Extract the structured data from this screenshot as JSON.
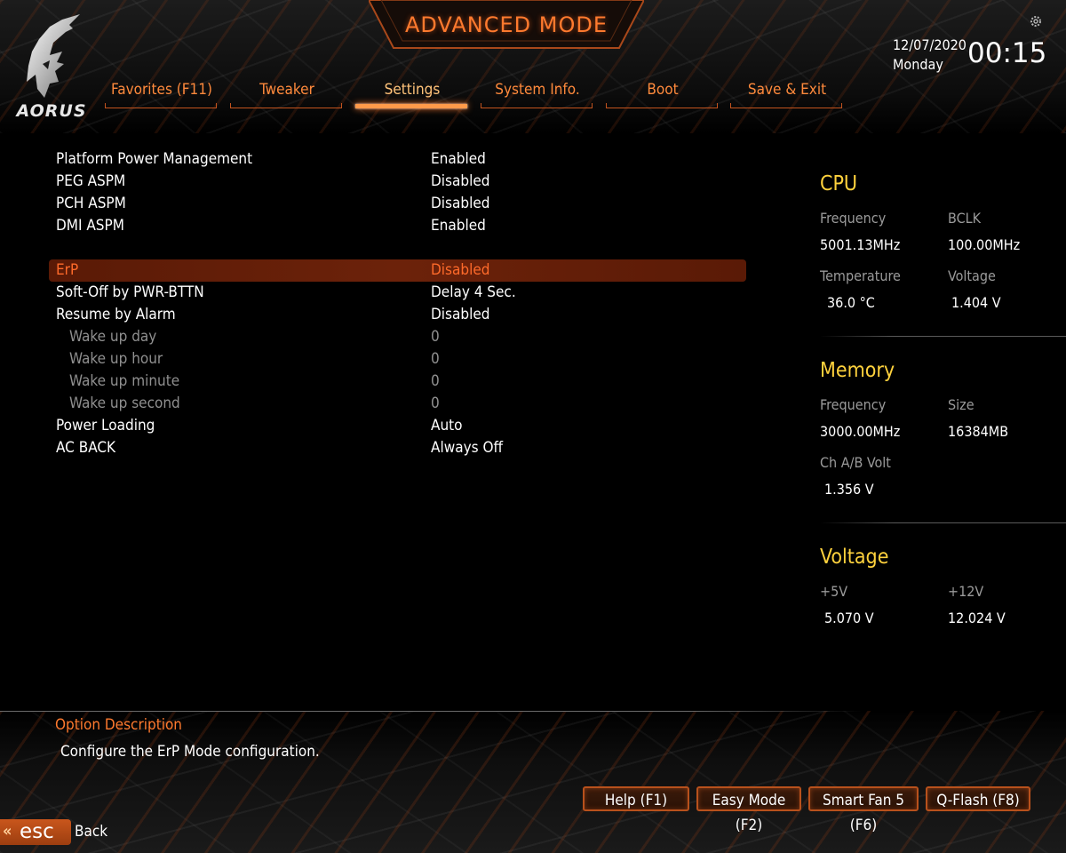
{
  "header": {
    "brand": "AORUS",
    "mode_title": "ADVANCED MODE",
    "date": "12/07/2020",
    "weekday": "Monday",
    "time": "00:15"
  },
  "tabs": [
    {
      "label": "Favorites (F11)",
      "active": false
    },
    {
      "label": "Tweaker",
      "active": false
    },
    {
      "label": "Settings",
      "active": true
    },
    {
      "label": "System Info.",
      "active": false
    },
    {
      "label": "Boot",
      "active": false
    },
    {
      "label": "Save & Exit",
      "active": false
    }
  ],
  "settings": [
    {
      "label": "Platform Power Management",
      "value": "Enabled"
    },
    {
      "label": "PEG ASPM",
      "value": "Disabled"
    },
    {
      "label": "PCH ASPM",
      "value": "Disabled"
    },
    {
      "label": "DMI ASPM",
      "value": "Enabled"
    },
    {
      "label": "ErP",
      "value": "Disabled",
      "selected": true
    },
    {
      "label": "Soft-Off by PWR-BTTN",
      "value": "Delay 4 Sec."
    },
    {
      "label": "Resume by Alarm",
      "value": "Disabled"
    },
    {
      "label": "Wake up day",
      "value": "0",
      "disabled": true
    },
    {
      "label": "Wake up hour",
      "value": "0",
      "disabled": true
    },
    {
      "label": "Wake up minute",
      "value": "0",
      "disabled": true
    },
    {
      "label": "Wake up second",
      "value": "0",
      "disabled": true
    },
    {
      "label": "Power Loading",
      "value": "Auto"
    },
    {
      "label": "AC BACK",
      "value": "Always Off"
    }
  ],
  "info": {
    "cpu": {
      "title": "CPU",
      "frequency_label": "Frequency",
      "frequency": "5001.13MHz",
      "bclk_label": "BCLK",
      "bclk": "100.00MHz",
      "temperature_label": "Temperature",
      "temperature": "36.0 °C",
      "voltage_label": "Voltage",
      "voltage": "1.404 V"
    },
    "memory": {
      "title": "Memory",
      "frequency_label": "Frequency",
      "frequency": "3000.00MHz",
      "size_label": "Size",
      "size": "16384MB",
      "volt_label": "Ch A/B Volt",
      "volt": "1.356 V"
    },
    "voltage": {
      "title": "Voltage",
      "v5_label": "+5V",
      "v5": "5.070 V",
      "v12_label": "+12V",
      "v12": "12.024 V"
    }
  },
  "description": {
    "title": "Option Description",
    "text": "Configure the ErP Mode configuration."
  },
  "footer": {
    "help": "Help (F1)",
    "easy_mode": "Easy Mode (F2)",
    "smart_fan": "Smart Fan 5 (F6)",
    "qflash": "Q-Flash (F8)",
    "esc": "esc",
    "back": "Back"
  },
  "colors": {
    "accent": "#ff7a2e",
    "info_title": "#ffd23d",
    "selected_row": "#6c220a"
  }
}
